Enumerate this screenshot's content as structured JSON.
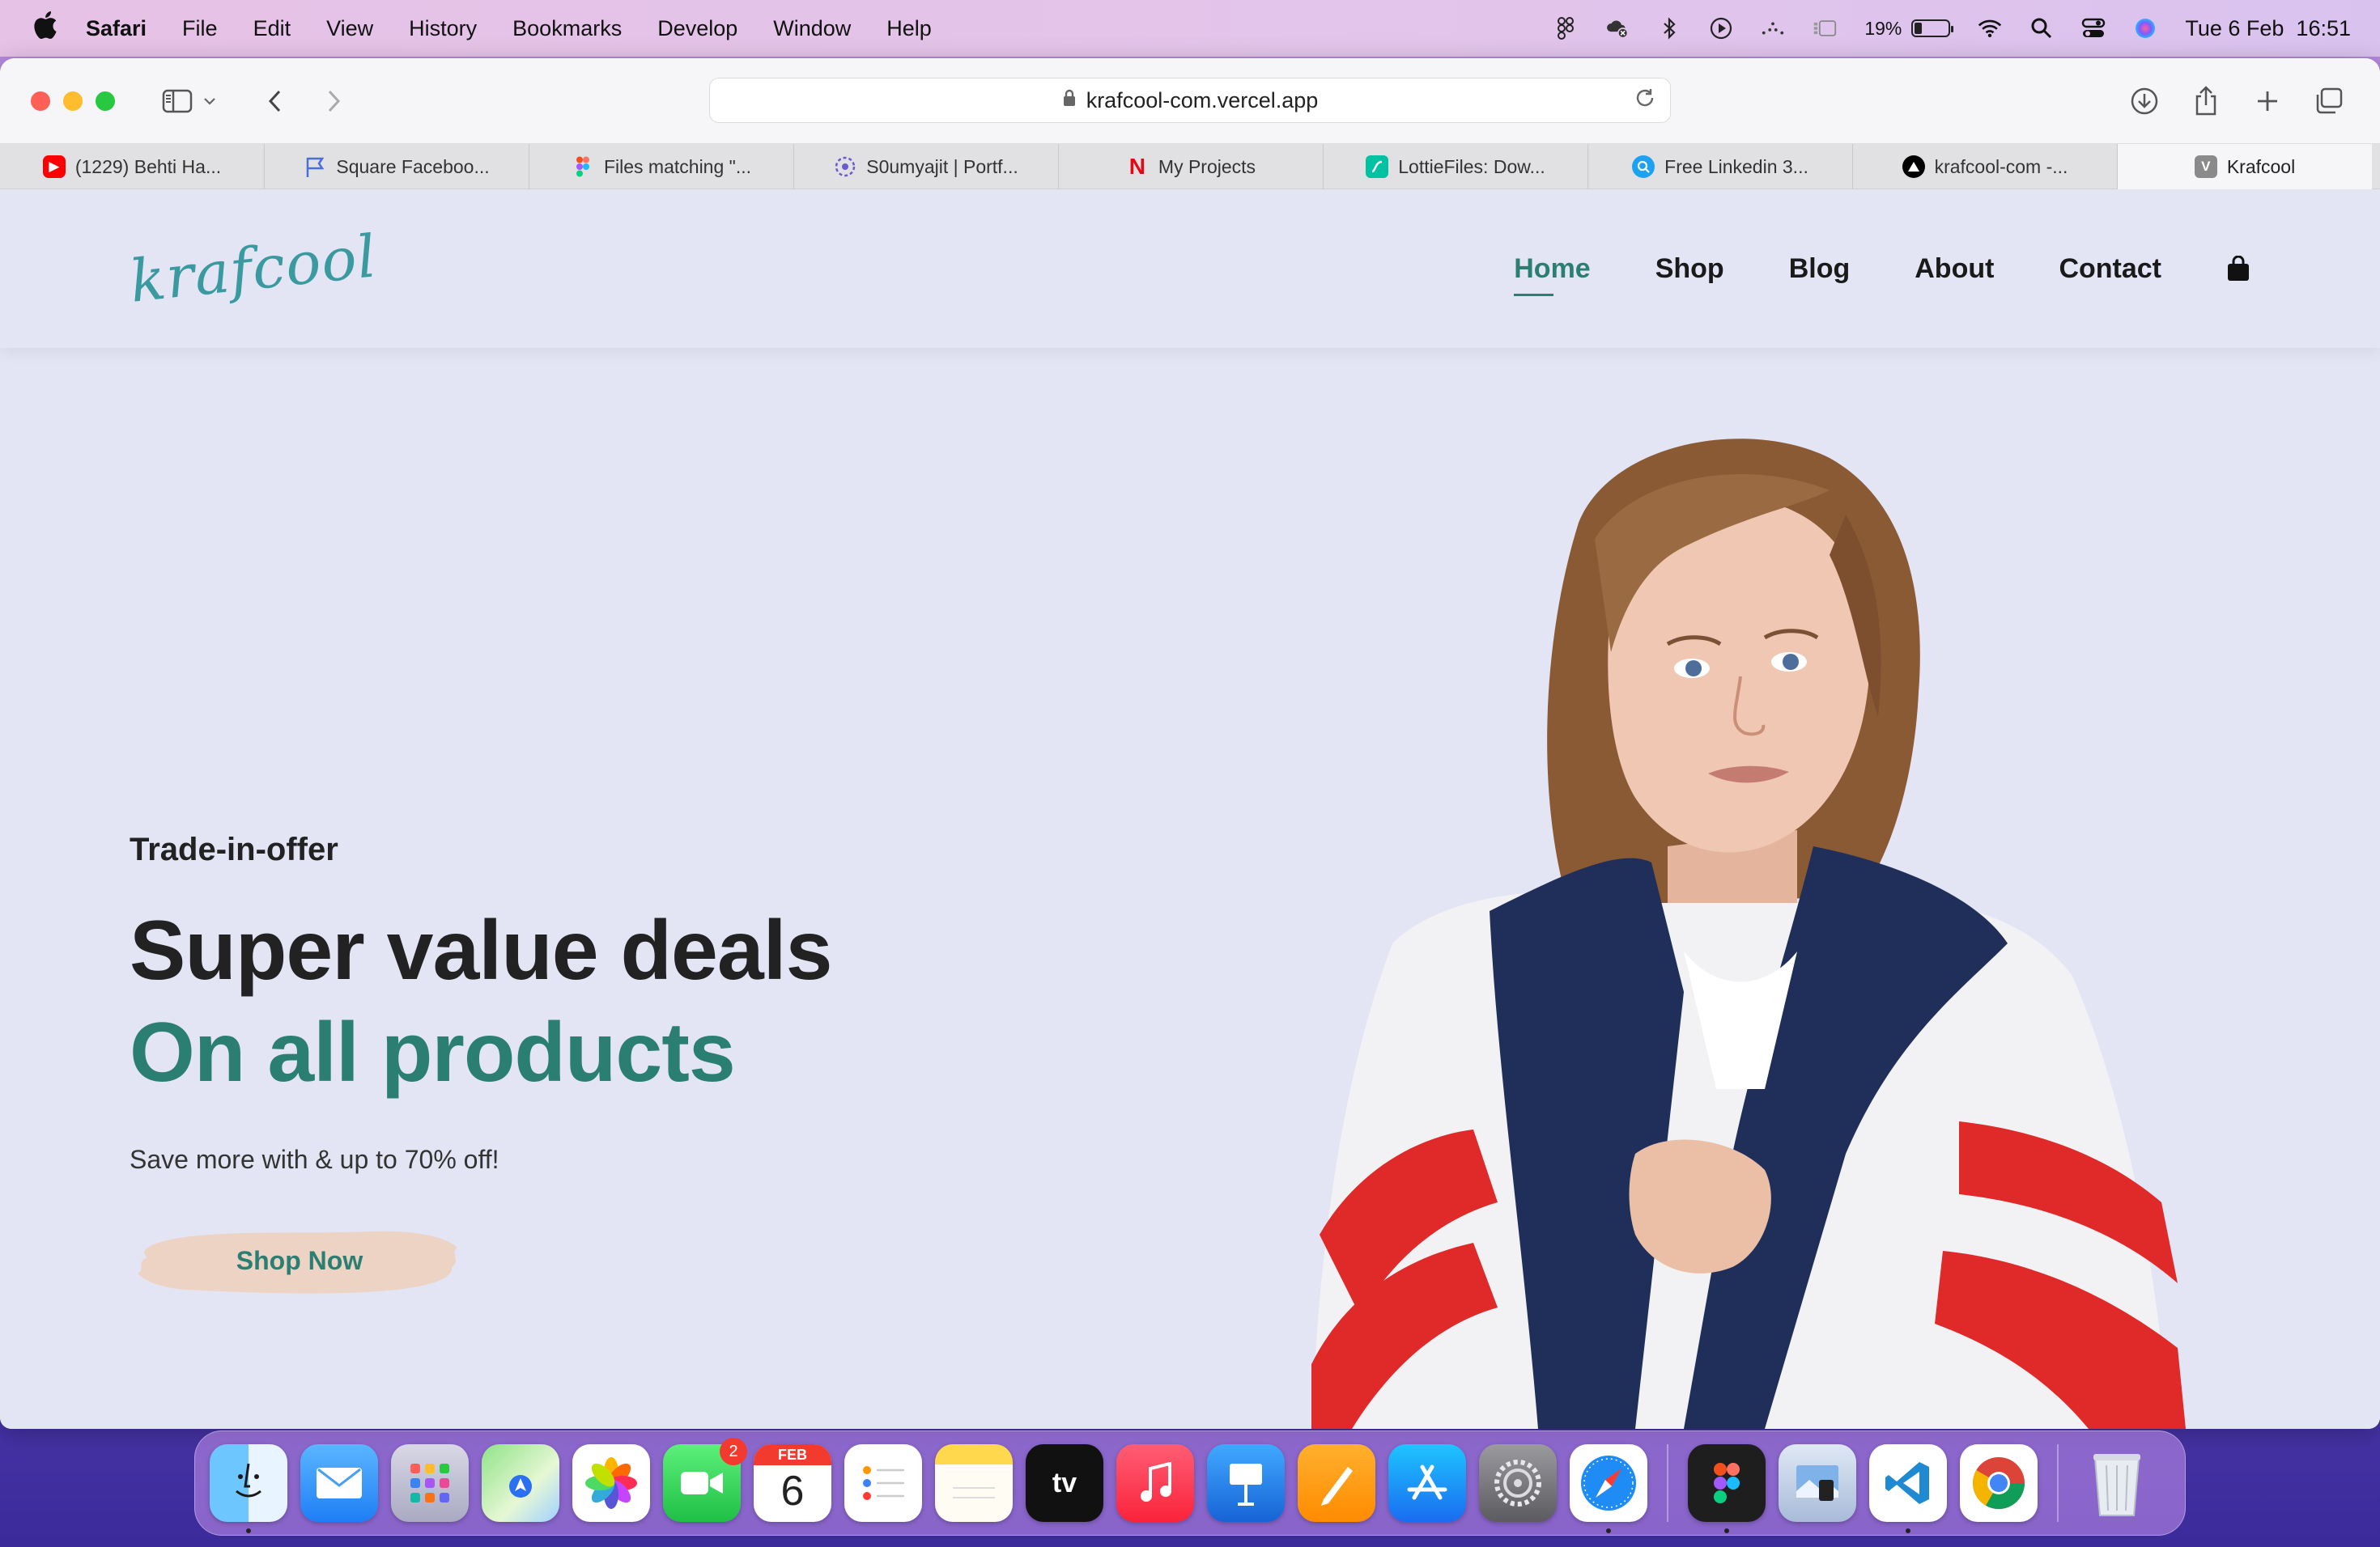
{
  "menubar": {
    "app": "Safari",
    "items": [
      "File",
      "Edit",
      "View",
      "History",
      "Bookmarks",
      "Develop",
      "Window",
      "Help"
    ],
    "battery": "19%",
    "battery_level": 0.19,
    "datetime": "Tue 6 Feb  16:51"
  },
  "browser": {
    "url": "krafcool-com.vercel.app",
    "tabs": [
      {
        "label": "(1229) Behti Ha...",
        "icon": "youtube-icon",
        "color": "#ff0000"
      },
      {
        "label": "Square Faceboo...",
        "icon": "flag-icon",
        "color": "#4a6fd8"
      },
      {
        "label": "Files matching \"...",
        "icon": "figma-icon",
        "color": "#a259ff"
      },
      {
        "label": "S0umyajit | Portf...",
        "icon": "portfolio-icon",
        "color": "#6a5acd"
      },
      {
        "label": "My Projects",
        "icon": "netflix-icon",
        "color": "#e50914"
      },
      {
        "label": "LottieFiles: Dow...",
        "icon": "lottie-icon",
        "color": "#00c1a2"
      },
      {
        "label": "Free Linkedin 3...",
        "icon": "search-icon",
        "color": "#1da1f2"
      },
      {
        "label": "krafcool-com -...",
        "icon": "vercel-icon",
        "color": "#000000"
      },
      {
        "label": "Krafcool",
        "icon": "v-icon",
        "color": "#888888"
      }
    ]
  },
  "site": {
    "logo": "krafcool",
    "nav": [
      "Home",
      "Shop",
      "Blog",
      "About",
      "Contact"
    ],
    "hero": {
      "kicker": "Trade-in-offer",
      "title": "Super value deals",
      "subtitle": "On all products",
      "description": "Save more with & up to 70% off!",
      "cta": "Shop Now"
    },
    "accent_color": "#2a7f72"
  },
  "dock": {
    "apps": [
      "Finder",
      "Mail",
      "Launchpad",
      "Maps",
      "Photos",
      "FaceTime",
      "Calendar",
      "Reminders",
      "Notes",
      "TV",
      "Music",
      "Keynote",
      "Pages",
      "App Store",
      "System Settings",
      "Safari",
      "Figma",
      "Preview",
      "Visual Studio Code",
      "Google Chrome",
      "Trash"
    ],
    "calendar_month": "FEB",
    "calendar_day": "6",
    "facetime_badge": "2"
  }
}
